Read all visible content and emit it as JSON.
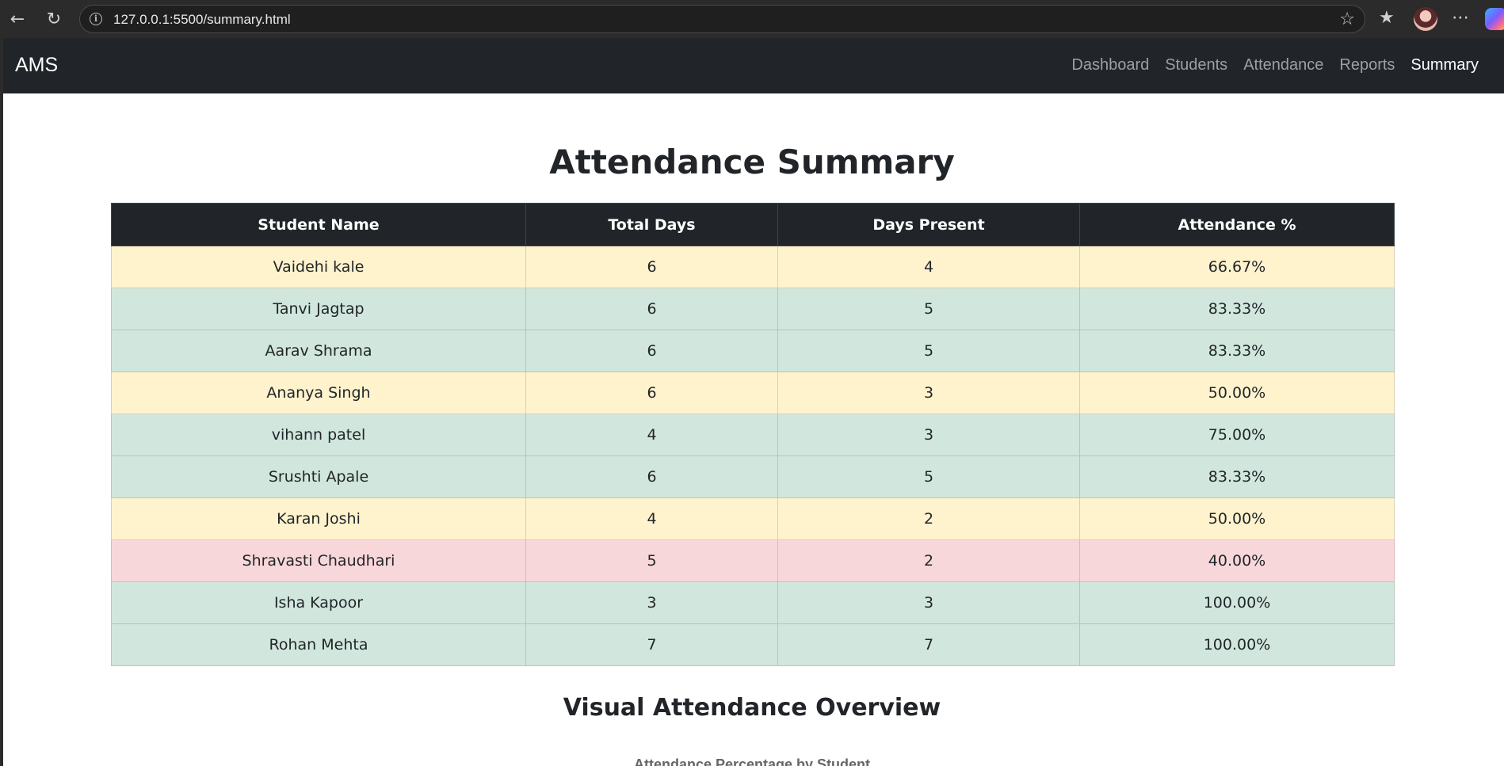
{
  "browser": {
    "url": "127.0.0.1:5500/summary.html"
  },
  "navbar": {
    "brand": "AMS",
    "links": [
      "Dashboard",
      "Students",
      "Attendance",
      "Reports",
      "Summary"
    ],
    "active": "Summary"
  },
  "page": {
    "title": "Attendance Summary",
    "section_title": "Visual Attendance Overview",
    "chart_title": "Attendance Percentage by Student"
  },
  "table": {
    "headers": [
      "Student Name",
      "Total Days",
      "Days Present",
      "Attendance %"
    ],
    "rows": [
      {
        "name": "Vaidehi kale",
        "total": "6",
        "present": "4",
        "percent": "66.67%",
        "status": "warning"
      },
      {
        "name": "Tanvi Jagtap",
        "total": "6",
        "present": "5",
        "percent": "83.33%",
        "status": "success"
      },
      {
        "name": "Aarav Shrama",
        "total": "6",
        "present": "5",
        "percent": "83.33%",
        "status": "success"
      },
      {
        "name": "Ananya Singh",
        "total": "6",
        "present": "3",
        "percent": "50.00%",
        "status": "warning"
      },
      {
        "name": "vihann patel",
        "total": "4",
        "present": "3",
        "percent": "75.00%",
        "status": "success"
      },
      {
        "name": "Srushti Apale",
        "total": "6",
        "present": "5",
        "percent": "83.33%",
        "status": "success"
      },
      {
        "name": "Karan Joshi",
        "total": "4",
        "present": "2",
        "percent": "50.00%",
        "status": "warning"
      },
      {
        "name": "Shravasti Chaudhari",
        "total": "5",
        "present": "2",
        "percent": "40.00%",
        "status": "danger"
      },
      {
        "name": "Isha Kapoor",
        "total": "3",
        "present": "3",
        "percent": "100.00%",
        "status": "success"
      },
      {
        "name": "Rohan Mehta",
        "total": "7",
        "present": "7",
        "percent": "100.00%",
        "status": "success"
      }
    ]
  },
  "colors": {
    "navbar": "#212529",
    "warning_row": "#fff3cd",
    "success_row": "#d1e7dd",
    "danger_row": "#f8d7da"
  }
}
